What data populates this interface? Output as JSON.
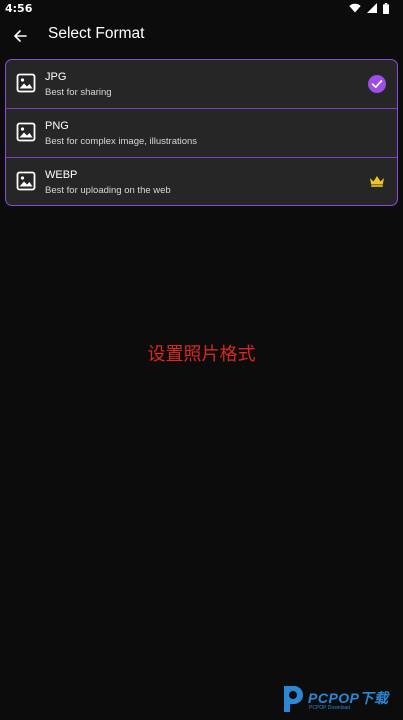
{
  "status_bar": {
    "time": "4:56",
    "icons": [
      "wifi-icon",
      "signal-icon",
      "battery-icon"
    ]
  },
  "app_bar": {
    "title": "Select Format",
    "back_icon": "arrow-left-icon"
  },
  "formats": [
    {
      "title": "JPG",
      "subtitle": "Best for sharing",
      "icon": "image-icon",
      "selected": true,
      "premium": false
    },
    {
      "title": "PNG",
      "subtitle": "Best for complex image, illustrations",
      "icon": "image-icon",
      "selected": false,
      "premium": false
    },
    {
      "title": "WEBP",
      "subtitle": "Best for uploading on the web",
      "icon": "image-icon",
      "selected": false,
      "premium": true
    }
  ],
  "caption": "设置照片格式",
  "watermark": {
    "text": "PCPOP下载",
    "sub": "PCPOP Download"
  },
  "colors": {
    "background": "#0c0c0c",
    "card": "#262626",
    "accent": "#8a4bd8",
    "check": "#9b4fe8",
    "crown": "#f2c521",
    "caption": "#d82820",
    "watermark": "#2a88d6"
  }
}
